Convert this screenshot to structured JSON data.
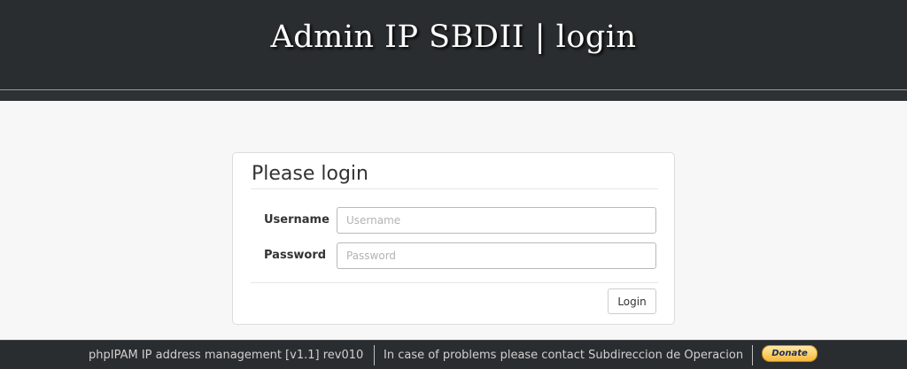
{
  "header": {
    "title": "Admin IP SBDII | login"
  },
  "login": {
    "title": "Please login",
    "username_label": "Username",
    "username_placeholder": "Username",
    "username_value": "",
    "password_label": "Password",
    "password_placeholder": "Password",
    "password_value": "",
    "login_button": "Login"
  },
  "footer": {
    "version_text": "phpIPAM IP address management [v1.1] rev010",
    "contact_text": "In case of problems please contact Subdireccion de Operacion",
    "donate_label": "Donate"
  },
  "colors": {
    "header_bg": "#2a2d30",
    "page_bg": "#f7f7f7",
    "donate_gold": "#f7b83a"
  }
}
